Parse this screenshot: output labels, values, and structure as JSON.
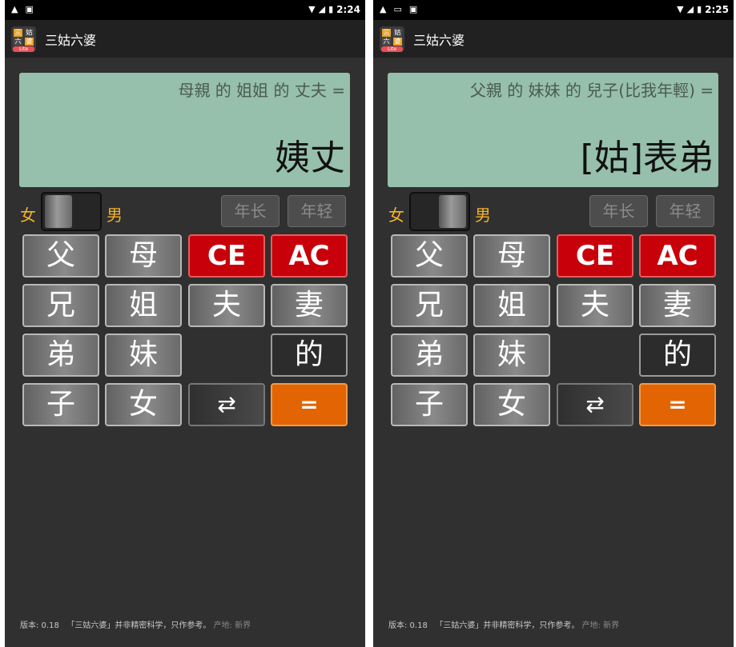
{
  "screens": [
    {
      "status": {
        "time": "2:24",
        "left_icons": [
          "warning-icon",
          "app-notification-icon"
        ]
      },
      "app": {
        "title": "三姑六婆",
        "logo_cells": [
          "三",
          "姑",
          "六",
          "婆"
        ],
        "logo_badge": "Lite"
      },
      "display": {
        "expression": "母親 的 姐姐 的 丈夫 =",
        "result": "姨丈"
      },
      "gender": {
        "female": "女",
        "male": "男",
        "selected": "女"
      },
      "age": {
        "older": "年长",
        "younger": "年轻"
      },
      "keys": {
        "father": "父",
        "mother": "母",
        "ce": "CE",
        "ac": "AC",
        "elder_brother": "兄",
        "elder_sister": "姐",
        "husband": "夫",
        "wife": "妻",
        "younger_brother": "弟",
        "younger_sister": "妹",
        "of": "的",
        "son": "子",
        "daughter": "女",
        "swap": "⇄",
        "equals": "="
      },
      "footer": {
        "version": "版本: 0.18",
        "disclaimer": "「三姑六婆」并非精密科学，只作参考。",
        "origin": "产地: 新界"
      }
    },
    {
      "status": {
        "time": "2:25",
        "left_icons": [
          "warning-icon",
          "image-notification-icon",
          "app-notification-icon"
        ]
      },
      "app": {
        "title": "三姑六婆",
        "logo_cells": [
          "三",
          "姑",
          "六",
          "婆"
        ],
        "logo_badge": "Lite"
      },
      "display": {
        "expression": "父親 的 妹妹 的 兒子(比我年輕) =",
        "result": "[姑]表弟"
      },
      "gender": {
        "female": "女",
        "male": "男",
        "selected": "男"
      },
      "age": {
        "older": "年长",
        "younger": "年轻"
      },
      "keys": {
        "father": "父",
        "mother": "母",
        "ce": "CE",
        "ac": "AC",
        "elder_brother": "兄",
        "elder_sister": "姐",
        "husband": "夫",
        "wife": "妻",
        "younger_brother": "弟",
        "younger_sister": "妹",
        "of": "的",
        "son": "子",
        "daughter": "女",
        "swap": "⇄",
        "equals": "="
      },
      "footer": {
        "version": "版本: 0.18",
        "disclaimer": "「三姑六婆」并非精密科学，只作参考。",
        "origin": "产地: 新界"
      }
    }
  ],
  "colors": {
    "display_bg": "#96bfac",
    "gender_label": "#f5b22a",
    "red_key": "#c8000a",
    "orange_key": "#e26403",
    "background": "#303030"
  }
}
